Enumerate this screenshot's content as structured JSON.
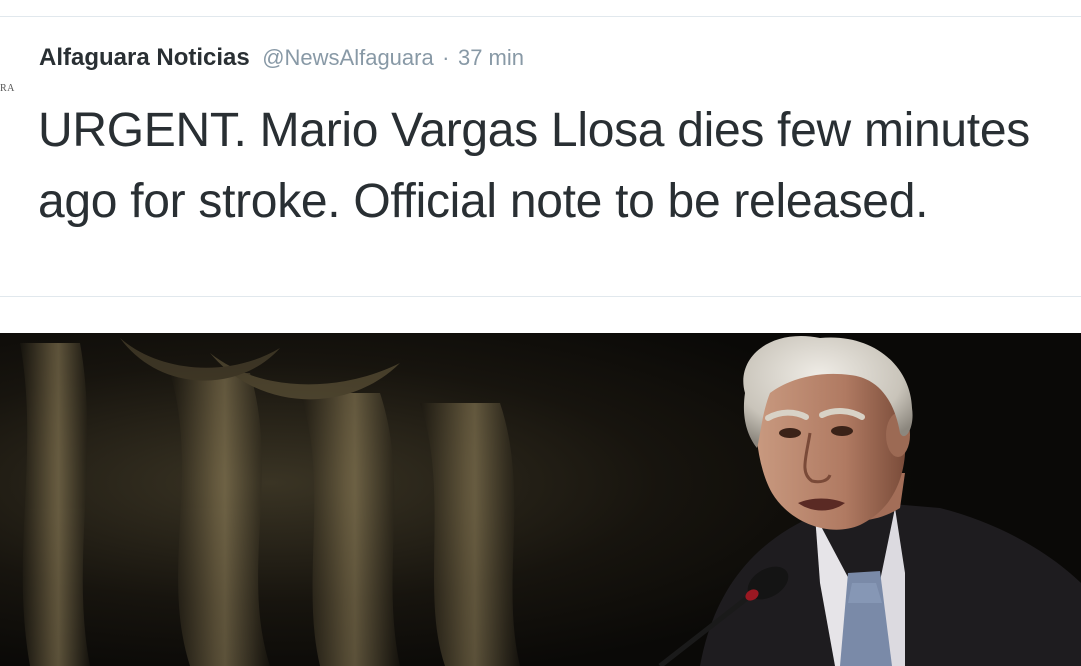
{
  "tweet": {
    "avatar_fragment": "RA",
    "author_name": "Alfaguara Noticias",
    "handle": "@NewsAlfaguara",
    "separator": "·",
    "time": "37 min",
    "text": "URGENT. Mario Vargas Llosa dies few minutes ago for stroke. Official note to be released."
  },
  "photo": {
    "colors": {
      "background": "#0b0a08",
      "curtain": "#8a7a55",
      "hair": "#d4d0c8",
      "skin": "#b88068",
      "suit": "#1e1c1f",
      "shirt": "#e6e4e8",
      "tie": "#7a8aa8",
      "mic_tip": "#9a1822"
    }
  }
}
